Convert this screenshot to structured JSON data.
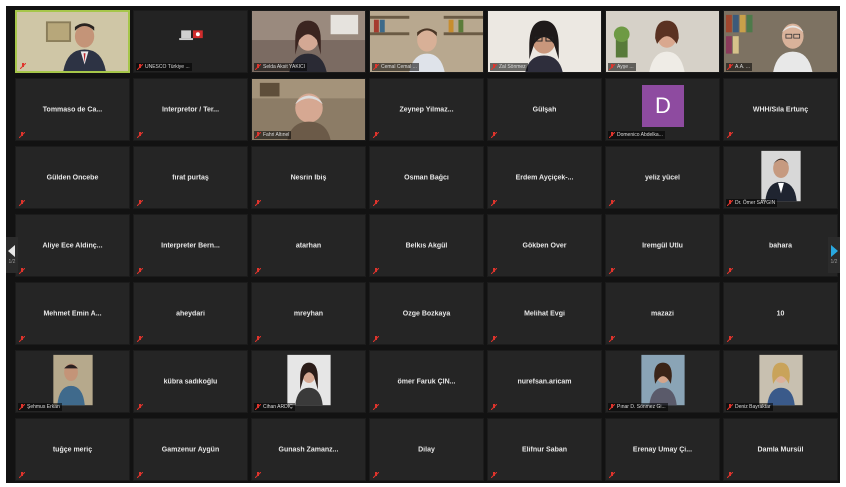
{
  "nav": {
    "prev_page": "1/2",
    "next_page": "1/2"
  },
  "colors": {
    "active_speaker": "#a6c64a",
    "muted_mic": "#e0342c",
    "tile_bg": "#252525",
    "nav_arrow": "#29a8e0"
  },
  "tiles": [
    {
      "name": "",
      "label": "",
      "video": "speaker",
      "active": true
    },
    {
      "name": "",
      "label": "UNESCO Türkiye ...",
      "video": "logo"
    },
    {
      "name": "",
      "label": "Selda Aksit YAKICI",
      "video": "woman1"
    },
    {
      "name": "",
      "label": "Cemal Cemal ...",
      "video": "man_shelves"
    },
    {
      "name": "",
      "label": "Zal Sönmez",
      "video": "woman_glasses"
    },
    {
      "name": "",
      "label": "Ayşe ...",
      "video": "woman2"
    },
    {
      "name": "",
      "label": "A.A. ...",
      "video": "man_books"
    },
    {
      "name": "Tommaso de Ca...",
      "label": ""
    },
    {
      "name": "Interpretor / Ter...",
      "label": ""
    },
    {
      "name": "",
      "label": "Fahri Altınel",
      "video": "man_old"
    },
    {
      "name": "Zeynep Yilmaz...",
      "label": ""
    },
    {
      "name": "Gülşah",
      "label": ""
    },
    {
      "name": "",
      "label": "Domenico Abdelka...",
      "video": "avatar",
      "avatar": "D"
    },
    {
      "name": "WHH/Sıla Ertunç",
      "label": ""
    },
    {
      "name": "Gülden Öncebe",
      "label": ""
    },
    {
      "name": "fırat purtaş",
      "label": ""
    },
    {
      "name": "Nesrin İbiş",
      "label": ""
    },
    {
      "name": "Osman Bağcı",
      "label": ""
    },
    {
      "name": "Erdem Ayçiçek-...",
      "label": ""
    },
    {
      "name": "yeliz yücel",
      "label": ""
    },
    {
      "name": "",
      "label": "Dr. Ömer SAYGIN",
      "video": "portrait"
    },
    {
      "name": "Aliye Ece Aldinç...",
      "label": ""
    },
    {
      "name": "Interpreter Bern...",
      "label": ""
    },
    {
      "name": "atarhan",
      "label": ""
    },
    {
      "name": "Belkıs Akgül",
      "label": ""
    },
    {
      "name": "Gökben Över",
      "label": ""
    },
    {
      "name": "İremgül Utlu",
      "label": ""
    },
    {
      "name": "bahara",
      "label": ""
    },
    {
      "name": "Mehmet Emin A...",
      "label": ""
    },
    {
      "name": "aheydari",
      "label": ""
    },
    {
      "name": "mreyhan",
      "label": ""
    },
    {
      "name": "Ozge Bozkaya",
      "label": ""
    },
    {
      "name": "Melihat Evgi",
      "label": ""
    },
    {
      "name": "mazazi",
      "label": ""
    },
    {
      "name": "10",
      "label": ""
    },
    {
      "name": "",
      "label": "Şehmus Erkan",
      "video": "man_small"
    },
    {
      "name": "kübra sadıkoğlu",
      "label": ""
    },
    {
      "name": "",
      "label": "Cihan ARDIÇ",
      "video": "woman_small"
    },
    {
      "name": "ömer Faruk ÇIN...",
      "label": ""
    },
    {
      "name": "nurefsan.aricam",
      "label": ""
    },
    {
      "name": "",
      "label": "Pınar D. Sönmez Gi...",
      "video": "woman_small2"
    },
    {
      "name": "",
      "label": "Deniz Bayraktar",
      "video": "woman_small3"
    },
    {
      "name": "tuğçe meriç",
      "label": ""
    },
    {
      "name": "Gamzenur Aygün",
      "label": ""
    },
    {
      "name": "Gunash Zamanz...",
      "label": ""
    },
    {
      "name": "Dilay",
      "label": ""
    },
    {
      "name": "Elifnur Saban",
      "label": ""
    },
    {
      "name": "Erenay Umay Çi...",
      "label": ""
    },
    {
      "name": "Damla Mursül",
      "label": ""
    }
  ]
}
